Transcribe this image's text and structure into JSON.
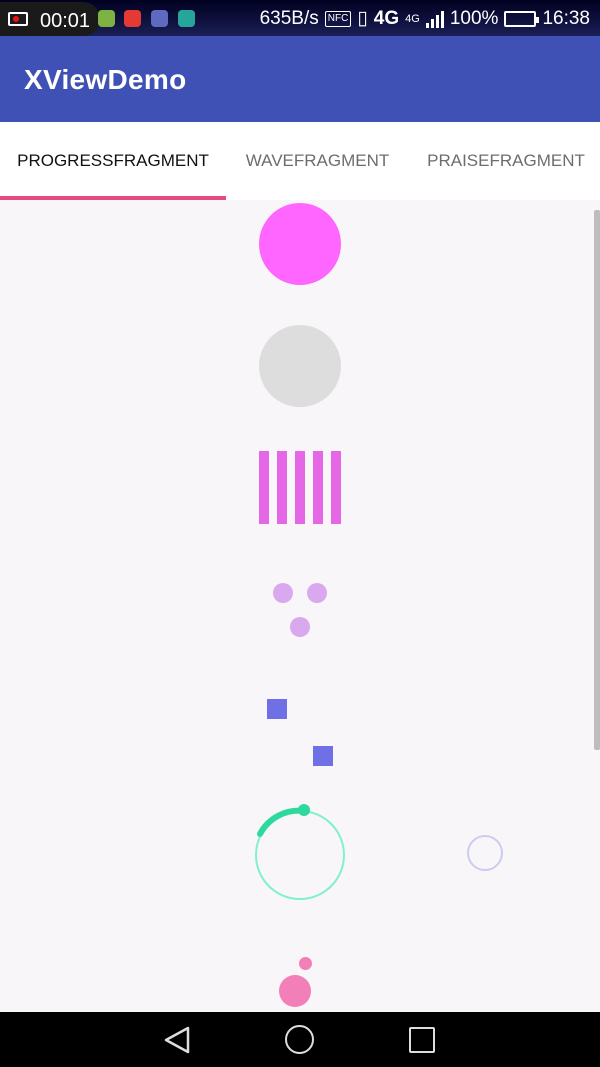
{
  "status_bar": {
    "record_time": "00:01",
    "net_speed": "635B/s",
    "nfc": "NFC",
    "network": "4G",
    "network_small": "4G",
    "battery": "100%",
    "clock": "16:38"
  },
  "app_bar": {
    "title": "XViewDemo",
    "color": "#3f51b5"
  },
  "tabs": [
    {
      "label": "PROGRESSFRAGMENT",
      "selected": true
    },
    {
      "label": "WAVEFRAGMENT",
      "selected": false
    },
    {
      "label": "PRAISEFRAGMENT",
      "selected": false
    }
  ],
  "colors": {
    "indicator": "#e64980",
    "pulse_circle": "#ff66ff",
    "grey_circle": "#dddddd",
    "bars": "#e667e6",
    "dots": "#d9a8ef",
    "squares": "#6f6fe6",
    "ring": "#2ed99e",
    "small_ring": "#ccccf0",
    "pink_balls": "#f27fb8"
  },
  "icons": {
    "nav_back": "back-triangle-icon",
    "nav_home": "home-circle-icon",
    "nav_recent": "recent-square-icon"
  }
}
